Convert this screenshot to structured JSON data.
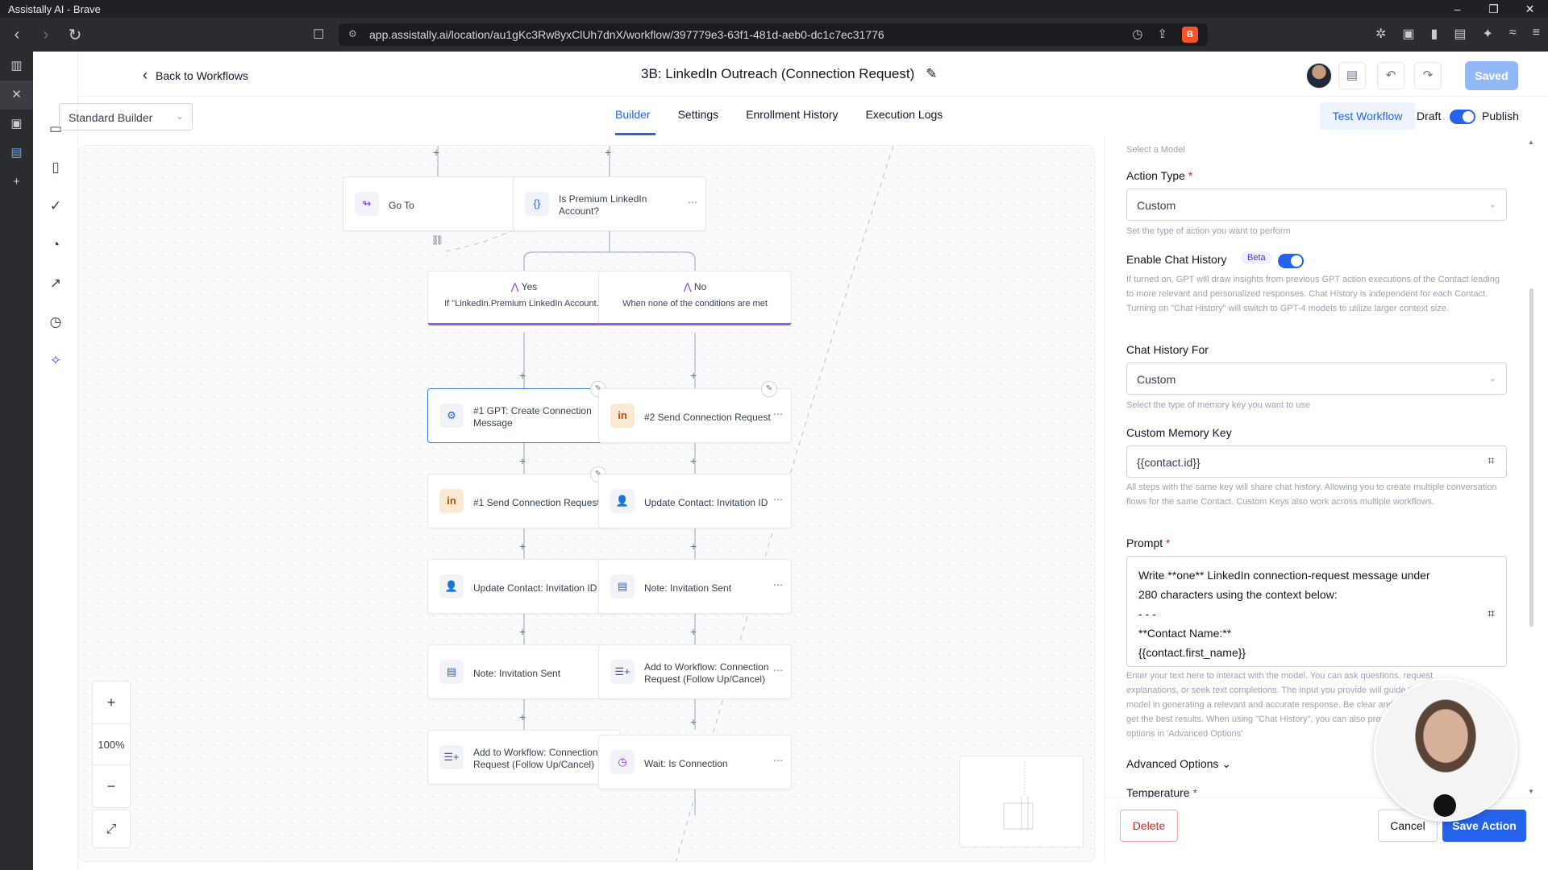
{
  "browser": {
    "window_title": "Assistally AI - Brave",
    "url": "app.assistally.ai/location/au1gKc3Rw8yxClUh7dnX/workflow/397779e3-63f1-481d-aeb0-dc1c7ec31776",
    "controls": {
      "minimize": "–",
      "maximize": "❐",
      "close": "✕"
    }
  },
  "header": {
    "back_label": "Back to Workflows",
    "title": "3B: LinkedIn Outreach (Connection Request)",
    "saved_label": "Saved"
  },
  "subheader": {
    "builder_select": "Standard Builder",
    "tabs": [
      "Builder",
      "Settings",
      "Enrollment History",
      "Execution Logs"
    ],
    "active_tab": "Builder",
    "test_workflow": "Test Workflow",
    "draft_label": "Draft",
    "publish_label": "Publish"
  },
  "canvas": {
    "nodes": {
      "goto": "Go To",
      "premium": "Is Premium LinkedIn Account?",
      "gpt": "#1 GPT: Create Connection Message",
      "send1": "#1 Send Connection Request",
      "update1": "Update Contact: Invitation ID",
      "note1": "Note: Invitation Sent",
      "add1": "Add to Workflow: Connection Request (Follow Up/Cancel)",
      "send2": "#2 Send Connection Request",
      "update2": "Update Contact: Invitation ID",
      "note2": "Note: Invitation Sent",
      "add2": "Add to Workflow: Connection Request (Follow Up/Cancel)",
      "wait2": "Wait: Is Connection"
    },
    "branches": {
      "yes_title": "Yes",
      "yes_sub": "If \"LinkedIn.Premium LinkedIn Account...",
      "no_title": "No",
      "no_sub": "When none of the conditions are met"
    },
    "zoom": "100%"
  },
  "panel": {
    "select_model_hint": "Select a Model",
    "action_type_label": "Action Type",
    "action_type_value": "Custom",
    "action_type_help": "Set the type of action you want to perform",
    "chat_history_label": "Enable Chat History",
    "beta": "Beta",
    "chat_history_help": "If turned on, GPT will draw insights from previous GPT action executions of the Contact leading to more relevant and personalized responses. Chat History is independent for each Contact. Turning on \"Chat History\" will switch to GPT-4 models to utilize larger context size.",
    "history_for_label": "Chat History For",
    "history_for_value": "Custom",
    "history_for_help": "Select the type of memory key you want to use",
    "memory_key_label": "Custom Memory Key",
    "memory_key_value": "{{contact.id}}",
    "memory_key_help": "All steps with the same key will share chat history. Allowing you to create multiple conversation flows for the same Contact. Custom Keys also work across multiple workflows.",
    "prompt_label": "Prompt",
    "prompt_lines": [
      "Write **one** LinkedIn connection-request message under",
      "280 characters using the context below:",
      "- - -",
      "**Contact Name:**",
      "{{contact.first_name}}"
    ],
    "prompt_help": "Enter your text here to interact with the model. You can ask questions, request explanations, or seek text completions. The input you provide will guide the model in generating a relevant and accurate response. Be clear and concise to get the best results. When using \"Chat History\", you can also provide additional options in 'Advanced Options'",
    "advanced_label": "Advanced Options",
    "temperature_label": "Temperature",
    "delete": "Delete",
    "cancel": "Cancel",
    "save": "Save Action"
  }
}
